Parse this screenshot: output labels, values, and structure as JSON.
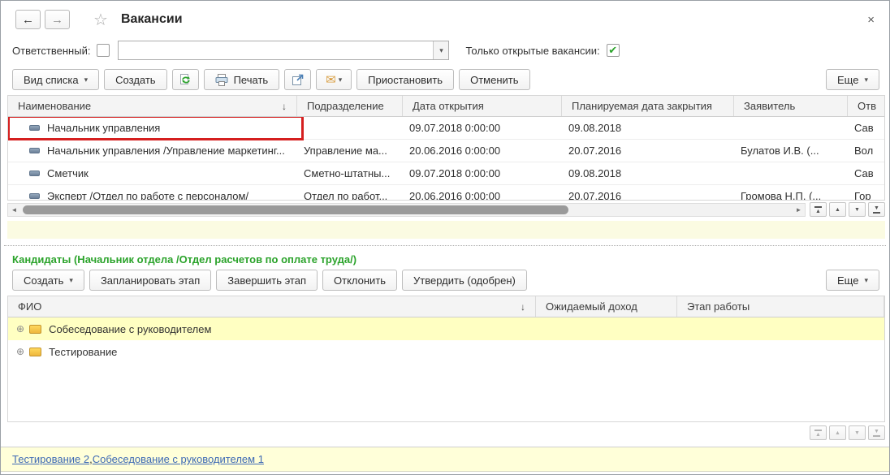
{
  "colors": {
    "accent_green": "#2ba32b",
    "link_blue": "#3d69b4",
    "highlight_red": "#d51f1f",
    "selected_yellow": "#ffffc2",
    "footer_yellow": "#ffffd9"
  },
  "icons": {
    "back": "←",
    "forward": "→",
    "star": "☆",
    "close": "×",
    "check": "✔",
    "caret": "▾",
    "sort_desc": "↓",
    "expand": "⊕",
    "mail": "✉",
    "scroll_left": "◄",
    "scroll_right": "►",
    "up": "▲",
    "down": "▼"
  },
  "titlebar": {
    "title": "Вакансии"
  },
  "filters": {
    "responsible_label": "Ответственный:",
    "responsible_value": "",
    "only_open_label": "Только открытые вакансии:"
  },
  "toolbar": {
    "view_list": "Вид списка",
    "create": "Создать",
    "print": "Печать",
    "suspend": "Приостановить",
    "cancel": "Отменить",
    "more": "Еще"
  },
  "vacancies": {
    "columns": {
      "name": "Наименование",
      "department": "Подразделение",
      "open_date": "Дата открытия",
      "planned_close": "Планируемая дата закрытия",
      "applicant": "Заявитель",
      "responsible": "Отв"
    },
    "rows": [
      {
        "name": "Начальник управления",
        "department": "",
        "open_date": "09.07.2018 0:00:00",
        "planned_close": "09.08.2018",
        "applicant": "",
        "responsible": "Сав"
      },
      {
        "name": "Начальник управления /Управление маркетинг...",
        "department": "Управление ма...",
        "open_date": "20.06.2016 0:00:00",
        "planned_close": "20.07.2016",
        "applicant": "Булатов И.В. (...",
        "responsible": "Вол"
      },
      {
        "name": "Сметчик",
        "department": "Сметно-штатны...",
        "open_date": "09.07.2018 0:00:00",
        "planned_close": "09.08.2018",
        "applicant": "",
        "responsible": "Сав"
      },
      {
        "name": "Эксперт /Отдел по работе с персоналом/",
        "department": "Отдел по работ...",
        "open_date": "20.06.2016 0:00:00",
        "planned_close": "20.07.2016",
        "applicant": "Громова Н.П. (...",
        "responsible": "Гор"
      }
    ]
  },
  "candidates": {
    "header": "Кандидаты (Начальник отдела /Отдел расчетов по оплате труда/)",
    "toolbar": {
      "create": "Создать",
      "plan_stage": "Запланировать этап",
      "finish_stage": "Завершить этап",
      "reject": "Отклонить",
      "approve": "Утвердить (одобрен)",
      "more": "Еще"
    },
    "columns": {
      "fio": "ФИО",
      "expected_income": "Ожидаемый доход",
      "stage": "Этап работы"
    },
    "rows": [
      {
        "name": "Собеседование с руководителем"
      },
      {
        "name": "Тестирование"
      }
    ]
  },
  "footer": {
    "links": [
      "Тестирование 2",
      "Собеседование с руководителем 1"
    ],
    "separator": ", "
  }
}
